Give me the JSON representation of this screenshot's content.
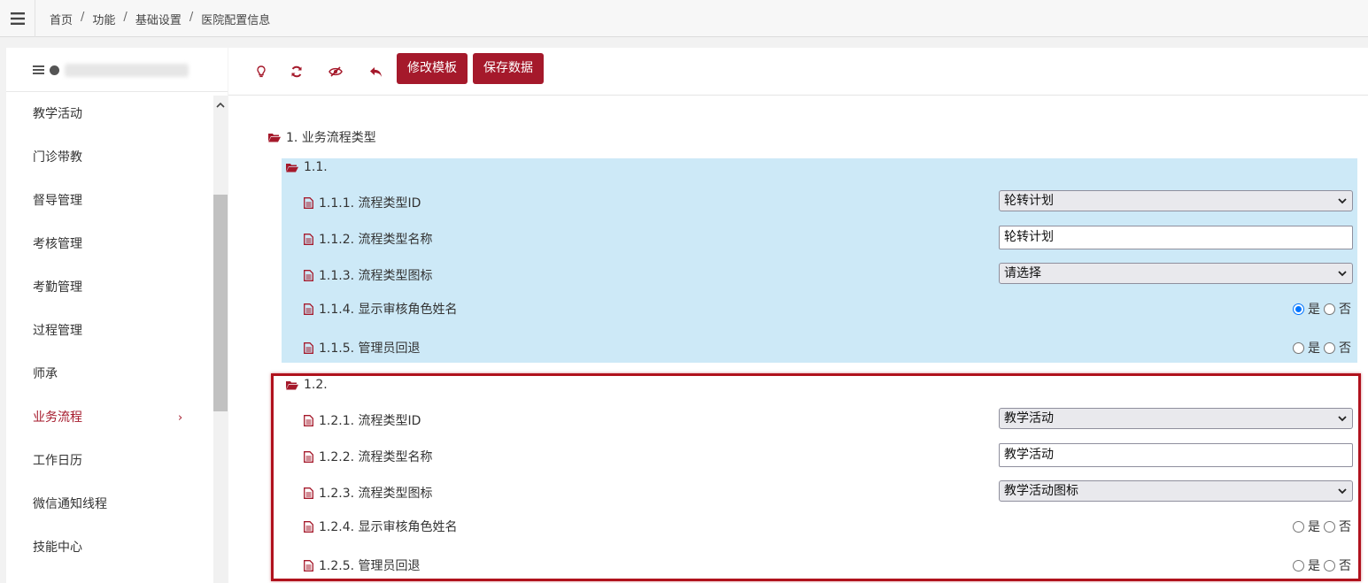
{
  "breadcrumb": [
    "首页",
    "功能",
    "基础设置",
    "医院配置信息"
  ],
  "sidebar": {
    "items": [
      {
        "label": "教学活动"
      },
      {
        "label": "门诊带教"
      },
      {
        "label": "督导管理"
      },
      {
        "label": "考核管理"
      },
      {
        "label": "考勤管理"
      },
      {
        "label": "过程管理"
      },
      {
        "label": "师承"
      },
      {
        "label": "业务流程",
        "active": true,
        "chevron": "›"
      },
      {
        "label": "工作日历"
      },
      {
        "label": "微信通知线程"
      },
      {
        "label": "技能中心"
      }
    ]
  },
  "toolbar": {
    "icons": [
      "lightbulb-icon",
      "refresh-icon",
      "eye-slash-icon",
      "undo-icon"
    ],
    "edit_template_label": "修改模板",
    "save_data_label": "保存数据"
  },
  "tree": {
    "root_label": "1. 业务流程类型",
    "groups": [
      {
        "label": "1.1.",
        "fields": [
          {
            "label": "1.1.1. 流程类型ID",
            "type": "select",
            "value": "轮转计划"
          },
          {
            "label": "1.1.2. 流程类型名称",
            "type": "input",
            "value": "轮转计划"
          },
          {
            "label": "1.1.3. 流程类型图标",
            "type": "select",
            "value": "请选择"
          },
          {
            "label": "1.1.4. 显示审核角色姓名",
            "type": "radio",
            "yes": "是",
            "no": "否",
            "selected": "yes"
          },
          {
            "label": "1.1.5. 管理员回退",
            "type": "radio",
            "yes": "是",
            "no": "否",
            "selected": null
          }
        ]
      },
      {
        "label": "1.2.",
        "fields": [
          {
            "label": "1.2.1. 流程类型ID",
            "type": "select",
            "value": "教学活动"
          },
          {
            "label": "1.2.2. 流程类型名称",
            "type": "input",
            "value": "教学活动"
          },
          {
            "label": "1.2.3. 流程类型图标",
            "type": "select",
            "value": "教学活动图标"
          },
          {
            "label": "1.2.4. 显示审核角色姓名",
            "type": "radio",
            "yes": "是",
            "no": "否",
            "selected": null
          },
          {
            "label": "1.2.5. 管理员回退",
            "type": "radio",
            "yes": "是",
            "no": "否",
            "selected": null
          }
        ]
      }
    ]
  },
  "colors": {
    "accent": "#a5192b",
    "group_highlight": "#cde9f7",
    "annotation_frame": "#b0121d",
    "radio_checked": "#0075ff"
  }
}
